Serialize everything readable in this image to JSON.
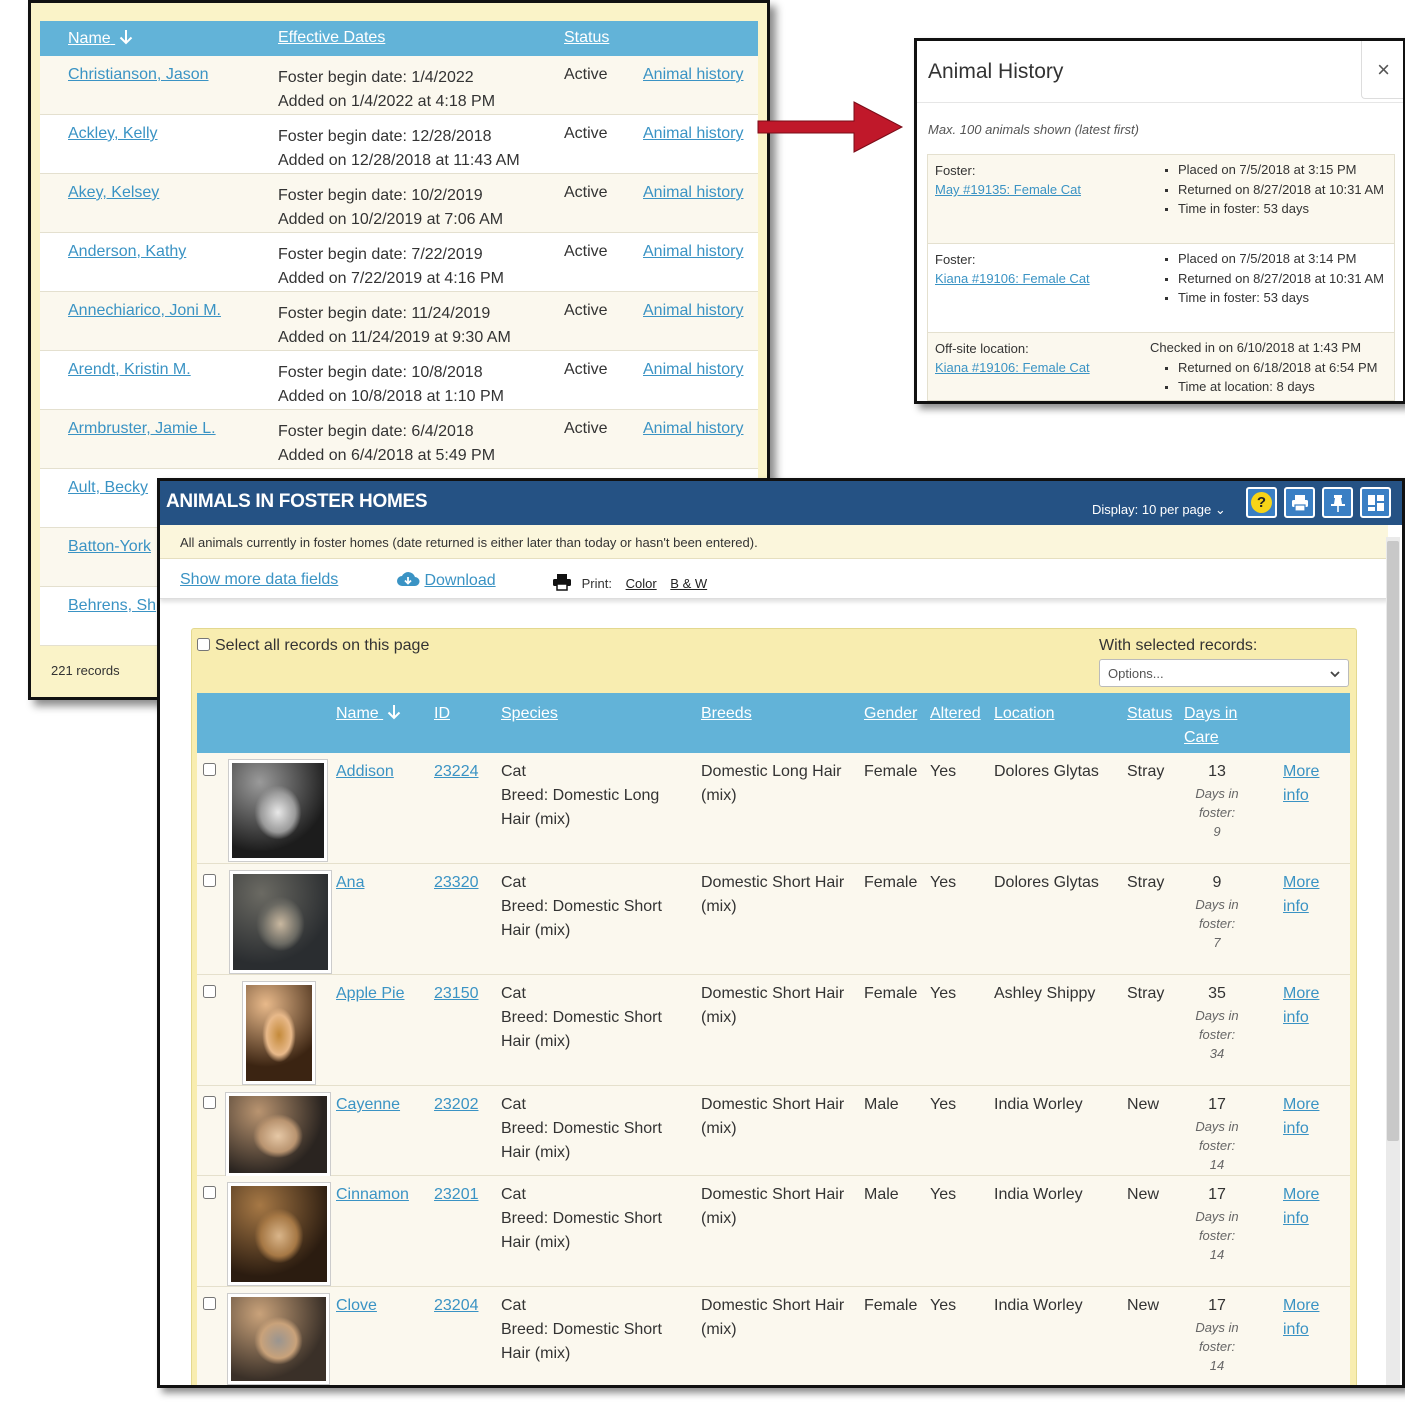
{
  "fosters": {
    "headers": {
      "name": "Name",
      "dates": "Effective Dates",
      "status": "Status"
    },
    "sort_icon": "arrow-down-icon",
    "rows": [
      {
        "name": "Christianson, Jason",
        "begin": "Foster begin date: 1/4/2022",
        "added": "Added on 1/4/2022 at 4:18 PM",
        "status": "Active",
        "history": "Animal history"
      },
      {
        "name": "Ackley, Kelly",
        "begin": "Foster begin date: 12/28/2018",
        "added": "Added on 12/28/2018 at 11:43 AM",
        "status": "Active",
        "history": "Animal history"
      },
      {
        "name": "Akey, Kelsey",
        "begin": "Foster begin date: 10/2/2019",
        "added": "Added on 10/2/2019 at 7:06 AM",
        "status": "Active",
        "history": "Animal history"
      },
      {
        "name": "Anderson, Kathy",
        "begin": "Foster begin date: 7/22/2019",
        "added": "Added on 7/22/2019 at 4:16 PM",
        "status": "Active",
        "history": "Animal history"
      },
      {
        "name": "Annechiarico, Joni M.",
        "begin": "Foster begin date: 11/24/2019",
        "added": "Added on 11/24/2019 at 9:30 AM",
        "status": "Active",
        "history": "Animal history"
      },
      {
        "name": "Arendt, Kristin M.",
        "begin": "Foster begin date: 10/8/2018",
        "added": "Added on 10/8/2018 at 1:10 PM",
        "status": "Active",
        "history": "Animal history"
      },
      {
        "name": "Armbruster, Jamie L.",
        "begin": "Foster begin date: 6/4/2018",
        "added": "Added on 6/4/2018 at 5:49 PM",
        "status": "Active",
        "history": "Animal history"
      },
      {
        "name": "Ault, Becky",
        "begin": "",
        "added": "",
        "status": "",
        "history": ""
      },
      {
        "name": "Batton-York",
        "begin": "",
        "added": "",
        "status": "",
        "history": ""
      },
      {
        "name": "Behrens, Sh",
        "begin": "",
        "added": "",
        "status": "",
        "history": ""
      }
    ],
    "count": "221 records"
  },
  "history_modal": {
    "title": "Animal History",
    "close": "×",
    "note": "Max. 100 animals shown (latest first)",
    "entries": [
      {
        "label": "Foster:",
        "animal": "May #19135: Female Cat",
        "lead": "",
        "items": [
          "Placed on 7/5/2018 at 3:15 PM",
          "Returned on 8/27/2018 at 10:31 AM",
          "Time in foster: 53 days"
        ]
      },
      {
        "label": "Foster:",
        "animal": "Kiana #19106: Female Cat",
        "lead": "",
        "items": [
          "Placed on 7/5/2018 at 3:14 PM",
          "Returned on 8/27/2018 at 10:31 AM",
          "Time in foster: 53 days"
        ]
      },
      {
        "label": "Off-site location:",
        "animal": "Kiana #19106: Female Cat",
        "lead": "Checked in on 6/10/2018 at 1:43 PM",
        "items": [
          "Returned on 6/18/2018 at 6:54 PM",
          "Time at location: 8 days"
        ]
      }
    ]
  },
  "foster_animals": {
    "title": "ANIMALS IN FOSTER HOMES",
    "display": "Display: 10 per page",
    "header_icons": [
      "help-icon",
      "print-icon",
      "pin-icon",
      "layout-icon"
    ],
    "header_glyphs": {
      "help": "?",
      "display_chevron": "⌄"
    },
    "description": "All animals currently in foster homes (date returned is either later than today or hasn't been entered).",
    "show_more": "Show more data fields",
    "download": "Download",
    "print_label": "Print:",
    "print_color": "Color",
    "print_bw": "B & W",
    "select_all": "Select all records on this page",
    "with_selected": "With selected records:",
    "options_placeholder": "Options...",
    "columns": {
      "name": "Name",
      "id": "ID",
      "species": "Species",
      "breeds": "Breeds",
      "gender": "Gender",
      "altered": "Altered",
      "location": "Location",
      "status": "Status",
      "days1": "Days in",
      "days2": "Care"
    },
    "more1": "More",
    "more2": "info",
    "days_sub_label": "Days in foster:",
    "rows": [
      {
        "name": "Addison",
        "id": "23224",
        "species": "Cat",
        "breed_line1": "Breed: Domestic Long",
        "breed_line2": "Hair (mix)",
        "breeds1": "Domestic Long Hair",
        "breeds2": "(mix)",
        "gender": "Female",
        "altered": "Yes",
        "location": "Dolores Glytas",
        "status": "Stray",
        "days": "13",
        "foster_days": "9",
        "photo_colors": [
          "#1c1c1c",
          "#e8e8e8",
          "#9a9a9a"
        ]
      },
      {
        "name": "Ana",
        "id": "23320",
        "species": "Cat",
        "breed_line1": "Breed: Domestic Short",
        "breed_line2": "Hair (mix)",
        "breeds1": "Domestic Short Hair",
        "breeds2": "(mix)",
        "gender": "Female",
        "altered": "Yes",
        "location": "Dolores Glytas",
        "status": "Stray",
        "days": "9",
        "foster_days": "7",
        "photo_colors": [
          "#2a2d30",
          "#c9b8a0",
          "#6b6a63"
        ]
      },
      {
        "name": "Apple Pie",
        "id": "23150",
        "species": "Cat",
        "breed_line1": "Breed: Domestic Short",
        "breed_line2": "Hair (mix)",
        "breeds1": "Domestic Short Hair",
        "breeds2": "(mix)",
        "gender": "Female",
        "altered": "Yes",
        "location": "Ashley Shippy",
        "status": "Stray",
        "days": "35",
        "foster_days": "34",
        "photo_colors": [
          "#3b2412",
          "#c48a3a",
          "#e8b98a"
        ]
      },
      {
        "name": "Cayenne",
        "id": "23202",
        "species": "Cat",
        "breed_line1": "Breed: Domestic Short",
        "breed_line2": "Hair (mix)",
        "breeds1": "Domestic Short Hair",
        "breeds2": "(mix)",
        "gender": "Male",
        "altered": "Yes",
        "location": "India Worley",
        "status": "New",
        "days": "17",
        "foster_days": "14",
        "photo_colors": [
          "#2a2420",
          "#e6c8a6",
          "#b99470"
        ]
      },
      {
        "name": "Cinnamon",
        "id": "23201",
        "species": "Cat",
        "breed_line1": "Breed: Domestic Short",
        "breed_line2": "Hair (mix)",
        "breeds1": "Domestic Short Hair",
        "breeds2": "(mix)",
        "gender": "Male",
        "altered": "Yes",
        "location": "India Worley",
        "status": "New",
        "days": "17",
        "foster_days": "14",
        "photo_colors": [
          "#2b1c10",
          "#d9b58a",
          "#a67845"
        ]
      },
      {
        "name": "Clove",
        "id": "23204",
        "species": "Cat",
        "breed_line1": "Breed: Domestic Short",
        "breed_line2": "Hair (mix)",
        "breeds1": "Domestic Short Hair",
        "breeds2": "(mix)",
        "gender": "Female",
        "altered": "Yes",
        "location": "India Worley",
        "status": "New",
        "days": "17",
        "foster_days": "14",
        "photo_colors": [
          "#3a3028",
          "#9a9590",
          "#c9a27a"
        ]
      }
    ]
  },
  "colors": {
    "table_header": "#62b3d8",
    "panel_header": "#255284",
    "link": "#3a93c4",
    "arrow": "#c0182a",
    "box": "#f8edb0"
  }
}
